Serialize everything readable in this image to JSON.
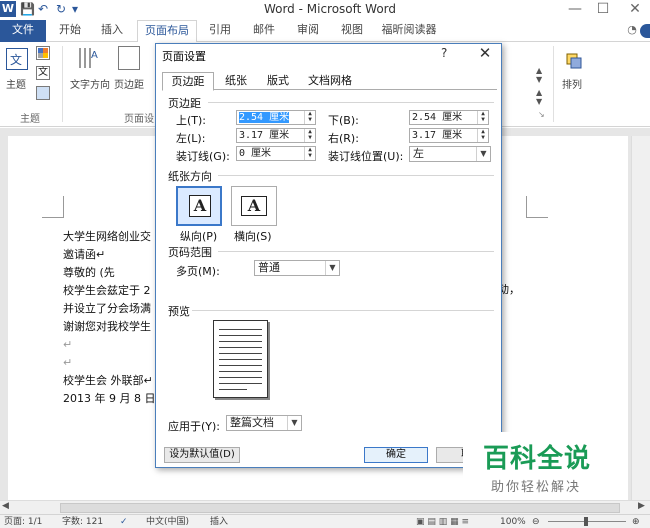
{
  "window": {
    "title": "Word - Microsoft Word",
    "app_icon_letter": "W",
    "qat": [
      "💾",
      "↶",
      "↻",
      "▾"
    ],
    "minimize": "—",
    "maximize": "☐",
    "close": "✕"
  },
  "tabs": [
    "文件",
    "开始",
    "插入",
    "页面布局",
    "引用",
    "邮件",
    "审阅",
    "视图",
    "福昕阅读器"
  ],
  "ribbon": {
    "theme_label": "主题",
    "text_direction": "文字方向",
    "margins": "页边距",
    "group_theme": "主题",
    "group_page_setup": "页面设",
    "arrange": "排列",
    "help_icon": "◔"
  },
  "document": {
    "lines": [
      "大学生网络创业交",
      "邀请函↵",
      "尊敬的        (先",
      "校学生会兹定于 2",
      "并设立了分会场满",
      "谢谢您对我校学生",
      "↵",
      "↵",
      "校学生会 外联部↵",
      "2013 年 9 月 8 日↵"
    ],
    "right_fragment": "动，"
  },
  "dialog": {
    "title": "页面设置",
    "help": "?",
    "close": "✕",
    "tabs": [
      "页边距",
      "纸张",
      "版式",
      "文档网格"
    ],
    "margins_section": "页边距",
    "top_label": "上(T):",
    "top_value": "2.54 厘米",
    "bottom_label": "下(B):",
    "bottom_value": "2.54 厘米",
    "left_label": "左(L):",
    "left_value": "3.17 厘米",
    "right_label": "右(R):",
    "right_value": "3.17 厘米",
    "gutter_label": "装订线(G):",
    "gutter_value": "0 厘米",
    "gutter_pos_label": "装订线位置(U):",
    "gutter_pos_value": "左",
    "orientation_section": "纸张方向",
    "portrait_label": "纵向(P)",
    "landscape_label": "横向(S)",
    "orient_glyph": "A",
    "pages_section": "页码范围",
    "multiple_pages_label": "多页(M):",
    "multiple_pages_value": "普通",
    "preview_section": "预览",
    "apply_label": "应用于(Y):",
    "apply_value": "整篇文档",
    "set_default": "设为默认值(D)",
    "ok": "确定",
    "cancel": "取"
  },
  "status": {
    "page": "页面: 1/1",
    "words": "字数: 121",
    "lang": "中文(中国)",
    "mode": "插入",
    "zoom": "100%"
  },
  "watermark": {
    "title": "百科全说",
    "subtitle": "助你轻松解决"
  }
}
